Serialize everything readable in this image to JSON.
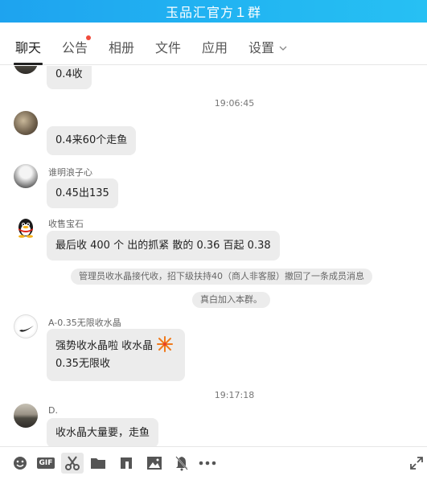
{
  "window": {
    "title": "玉品汇官方１群"
  },
  "tabs": [
    {
      "label": "聊天",
      "active": true
    },
    {
      "label": "公告",
      "badge": true
    },
    {
      "label": "相册"
    },
    {
      "label": "文件"
    },
    {
      "label": "应用"
    },
    {
      "label": "设置"
    }
  ],
  "messages": {
    "m0": {
      "text": "0.4收"
    },
    "t1": "19:06:45",
    "m1": {
      "text": "0.4来60个走鱼"
    },
    "m2": {
      "sender": "谁明浪子心",
      "text": "0.45出135"
    },
    "m3": {
      "sender": "收售宝石",
      "text": "最后收 400 个 出的抓紧 散的 0.36 百起 0.38"
    },
    "sys1": "管理员收水晶接代收，招下级扶持40（商人非客服）撤回了一条成员消息",
    "sys2": "真白加入本群。",
    "m4": {
      "sender": "A-0.35无限收水晶",
      "line1": "强势收水晶啦 收水晶",
      "line2": "0.35无限收"
    },
    "t2": "19:17:18",
    "m5": {
      "sender": "D.",
      "text": "收水晶大量要，走鱼"
    }
  },
  "toolbar": {
    "icons": [
      "emoji-icon",
      "gif-icon",
      "scissors-icon",
      "folder-icon",
      "music-icon",
      "image-icon",
      "notify-icon",
      "more-icon",
      "expand-icon"
    ],
    "gif_label": "GIF"
  },
  "colors": {
    "titlebar": "#22b6f2",
    "bubble": "#ececec",
    "badge": "#f04b3c"
  }
}
